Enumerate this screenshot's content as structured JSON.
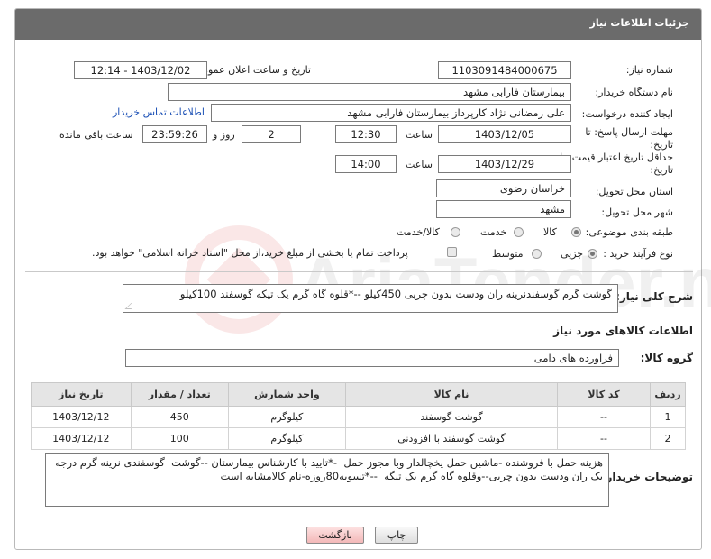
{
  "header": {
    "title": "جزئیات اطلاعات نیاز"
  },
  "fields": {
    "need_number": {
      "label": "شماره نیاز:",
      "value": "1103091484000675"
    },
    "announce_datetime": {
      "label": "تاریخ و ساعت اعلان عمومی:",
      "value": "1403/12/02 - 12:14"
    },
    "buyer_org": {
      "label": "نام دستگاه خریدار:",
      "value": "بیمارستان فارابی مشهد"
    },
    "requester": {
      "label": "ایجاد کننده درخواست:",
      "value": "علی رمضانی نژاد کارپرداز بیمارستان فارابی مشهد",
      "link": "اطلاعات تماس خریدار"
    },
    "reply_deadline": {
      "label_line1": "مهلت ارسال پاسخ: تا",
      "label_line2": "تاریخ:",
      "date": "1403/12/05",
      "time_label": "ساعت",
      "time": "12:30",
      "days": "2",
      "days_label": "روز و",
      "remaining": "23:59:26",
      "remaining_label": "ساعت باقی مانده"
    },
    "price_validity": {
      "label_line1": "حداقل تاریخ اعتبار قیمت: تا",
      "label_line2": "تاریخ:",
      "date": "1403/12/29",
      "time_label": "ساعت",
      "time": "14:00"
    },
    "delivery_province": {
      "label": "استان محل تحویل:",
      "value": "خراسان رضوی"
    },
    "delivery_city": {
      "label": "شهر محل تحویل:",
      "value": "مشهد"
    },
    "category": {
      "label": "طبقه بندی موضوعی:",
      "options": [
        "کالا",
        "خدمت",
        "کالا/خدمت"
      ],
      "selected": "کالا"
    },
    "purchase_process": {
      "label": "نوع فرآیند خرید :",
      "options": [
        "جزیی",
        "متوسط"
      ],
      "selected": "جزیی",
      "payment_note": "پرداخت تمام یا بخشی از مبلغ خرید،از محل \"اسناد خزانه اسلامی\" خواهد بود."
    }
  },
  "description": {
    "label": "شرح کلی نیاز:",
    "value": "گوشت گرم گوسفندنرینه ران ودست بدون چربی 450کیلو --*قلوه گاه گرم یک تیکه گوسفند 100کیلو"
  },
  "goods_section": {
    "title": "اطلاعات کالاهای مورد نیاز"
  },
  "goods_group": {
    "label": "گروه کالا:",
    "value": "فراورده های دامی"
  },
  "table": {
    "columns": [
      "ردیف",
      "کد کالا",
      "نام کالا",
      "واحد شمارش",
      "تعداد / مقدار",
      "تاریخ نیاز"
    ],
    "rows": [
      {
        "row": "1",
        "code": "--",
        "name": "گوشت گوسفند",
        "unit": "کیلوگرم",
        "qty": "450",
        "date": "1403/12/12"
      },
      {
        "row": "2",
        "code": "--",
        "name": "گوشت گوسفند با افزودنی",
        "unit": "کیلوگرم",
        "qty": "100",
        "date": "1403/12/12"
      }
    ]
  },
  "buyer_notes": {
    "label": "توضیحات خریدار:",
    "value": "هزینه حمل با فروشنده -ماشین حمل یخچالدار وبا مجوز حمل  -*تایید با کارشناس بیمارستان --گوشت  گوسفندی نرینه گرم درجه یک ران ودست بدون چربی--وقلوه گاه گرم یک تیگه  --*تسویه80روزه-نام کالامشابه است"
  },
  "buttons": {
    "print": "چاپ",
    "back": "بازگشت"
  },
  "watermark": {
    "text": "AriaTender.net"
  }
}
